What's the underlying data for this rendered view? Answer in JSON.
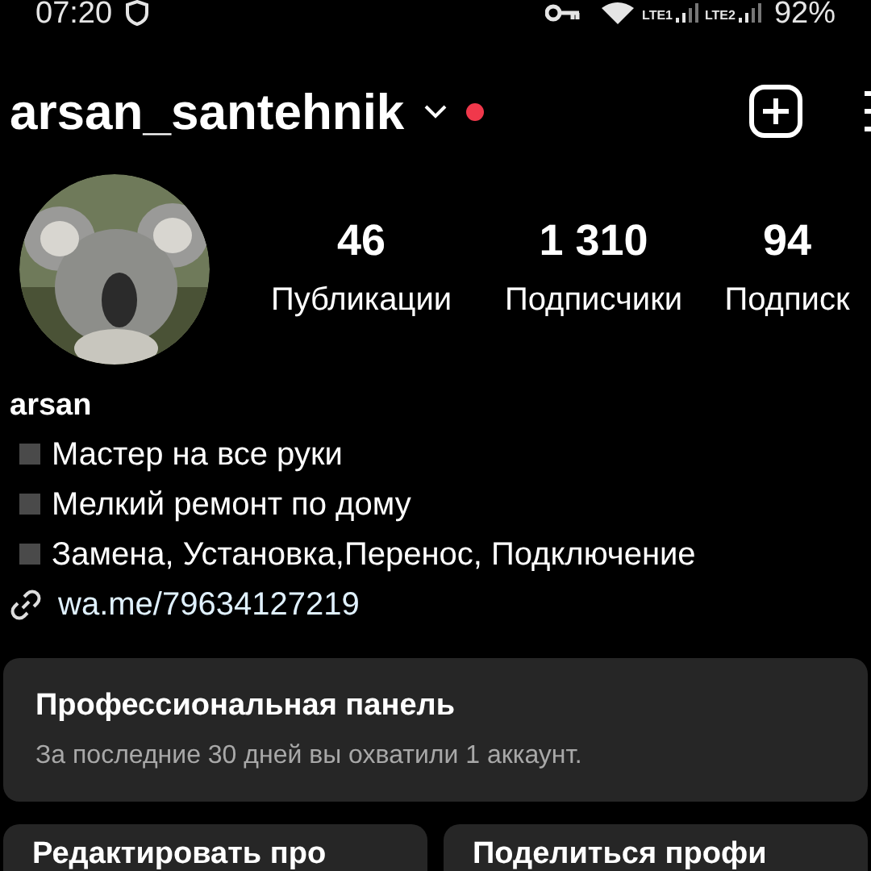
{
  "status_bar": {
    "time": "07:20",
    "sim_labels": [
      "LTE1",
      "LTE2"
    ],
    "battery": "92%"
  },
  "header": {
    "username": "arsan_santehnik",
    "has_notification": true
  },
  "stats": [
    {
      "value": "46",
      "label": "Публикации"
    },
    {
      "value": "1 310",
      "label": "Подписчики"
    },
    {
      "value": "94",
      "label": "Подписк"
    }
  ],
  "profile": {
    "name": "arsan",
    "bio": [
      "Мастер на все руки",
      "Мелкий ремонт по дому",
      "Замена, Установка,Перенос, Подключение"
    ],
    "link": "wa.me/79634127219"
  },
  "dashboard": {
    "title": "Профессиональная панель",
    "subtitle": "За последние 30 дней вы охватили 1 аккаунт."
  },
  "buttons": [
    "Редактировать про",
    "Поделиться профи"
  ]
}
